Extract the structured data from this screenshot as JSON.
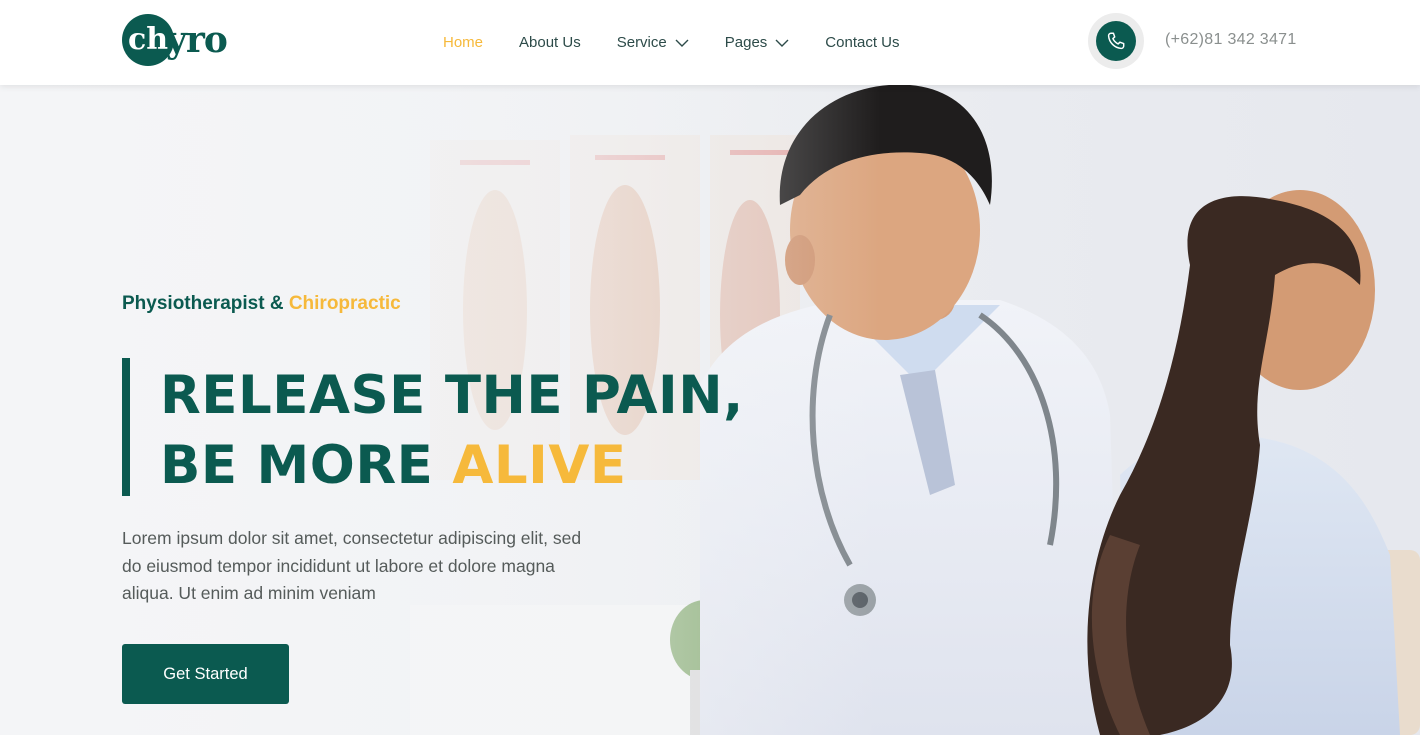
{
  "brand": {
    "logo_mark": "ch",
    "logo_text": "yro",
    "color": "#0b5a50",
    "accent": "#f6b93b"
  },
  "nav": {
    "items": [
      {
        "label": "Home",
        "active": true
      },
      {
        "label": "About Us"
      },
      {
        "label": "Service",
        "dropdown": true
      },
      {
        "label": "Pages",
        "dropdown": true
      },
      {
        "label": "Contact Us"
      }
    ]
  },
  "header": {
    "phone_icon": "phone-icon",
    "phone_number": "(+62)81 342 3471"
  },
  "hero": {
    "subtitle_main": "Physiotherapist & ",
    "subtitle_accent": "Chiropractic",
    "headline_line1": "RELEASE THE PAIN,",
    "headline_line2_main": "BE MORE ",
    "headline_line2_accent": "ALIVE",
    "description": "Lorem ipsum dolor sit amet, consectetur adipiscing elit, sed do eiusmod tempor incididunt ut labore et dolore magna aliqua. Ut enim ad minim veniam",
    "cta_label": "Get Started"
  }
}
